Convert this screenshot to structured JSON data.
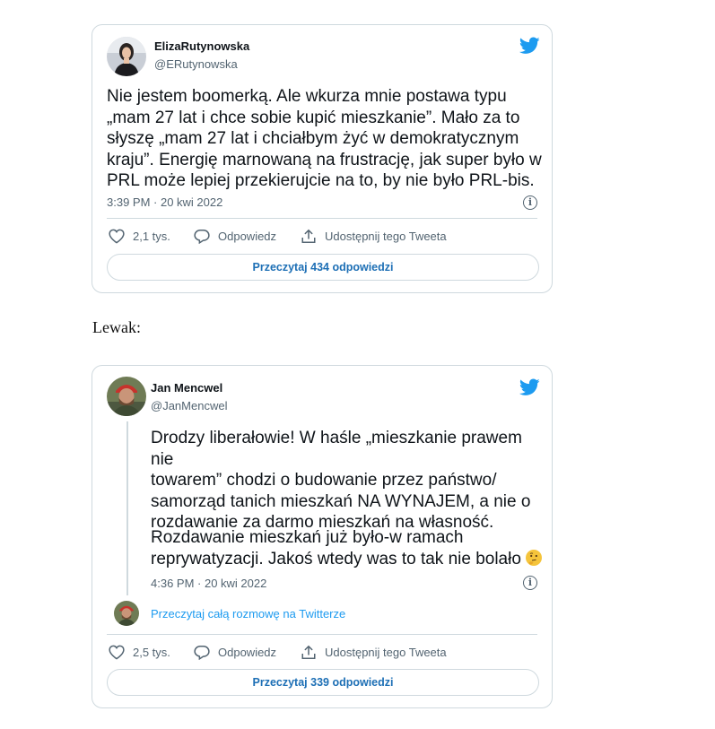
{
  "tweet1": {
    "display_name": "ElizaRutynowska",
    "handle": "@ERutynowska",
    "text": "Nie jestem boomerką. Ale wkurza mnie postawa typu\n„mam 27 lat i chce sobie kupić mieszkanie”. Mało za to\nsłyszę „mam 27 lat i chciałbym żyć w demokratycznym\nkraju”. Energię marnowaną na frustrację, jak super było w\nPRL może lepiej przekierujcie na to, by nie było PRL-bis.",
    "timestamp": "3:39 PM · 20 kwi 2022",
    "likes": "2,1 tys.",
    "reply_label": "Odpowiedz",
    "share_label": "Udostępnij tego Tweeta",
    "read_replies": "Przeczytaj 434 odpowiedzi"
  },
  "between_text": "Lewak:",
  "tweet2": {
    "display_name": "Jan Mencwel",
    "handle": "@JanMencwel",
    "text_p1": "Drodzy liberałowie! W haśle „mieszkanie prawem nie\ntowarem” chodzi o budowanie przez państwo/\nsamorząd tanich mieszkań NA WYNAJEM, a nie o\nrozdawanie za darmo mieszkań na własność.",
    "text_p2_line1": "Rozdawanie mieszkań już było-w ramach",
    "text_p2_line2": "reprywatyzacji. Jakoś wtedy was to tak nie bolało",
    "timestamp": "4:36 PM · 20 kwi 2022",
    "conversation_link": "Przeczytaj całą rozmowę na Twitterze",
    "likes": "2,5 tys.",
    "reply_label": "Odpowiedz",
    "share_label": "Udostępnij tego Tweeta",
    "read_replies": "Przeczytaj 339 odpowiedzi"
  },
  "icons": {
    "brand": "twitter-bird-icon",
    "like": "heart-icon",
    "reply": "speech-bubble-icon",
    "share": "share-arrow-icon",
    "info": "info-icon",
    "emoji": "thinking-face-emoji"
  },
  "colors": {
    "twitter_blue": "#1d9bf0",
    "link_blue": "#1d6fb5",
    "secondary_text": "#536471",
    "border": "#cfd9de"
  }
}
